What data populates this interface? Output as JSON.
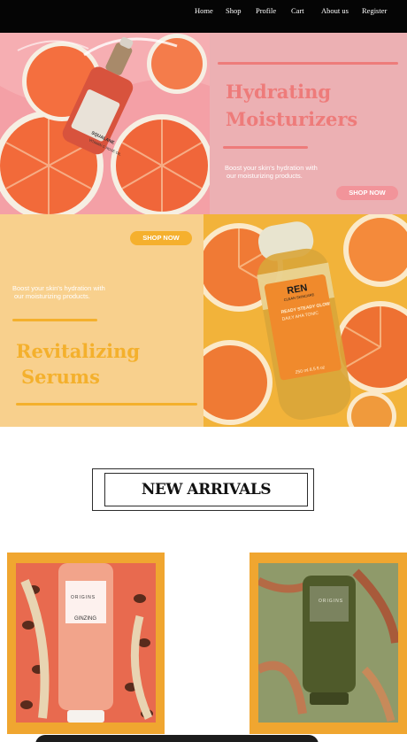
{
  "nav": {
    "items": [
      {
        "id": "home",
        "label": "Home"
      },
      {
        "id": "shop",
        "label": "Shop"
      },
      {
        "id": "profile",
        "label": "Profile"
      },
      {
        "id": "cart",
        "label": "Cart"
      },
      {
        "id": "about",
        "label": "About us"
      },
      {
        "id": "register",
        "label": "Register"
      }
    ]
  },
  "hero_moisturizers": {
    "title_line1": "Hydrating",
    "title_line2": "Moisturizers",
    "text_line1": "Boost your skin's hydration with",
    "text_line2": "our moisturizing products.",
    "cta": "SHOP NOW",
    "bottle_label_line1": "SQUALANE",
    "bottle_label_line2": "VITAMIN C ROSE OIL",
    "colors": {
      "panel": "#ecb0b3",
      "accent": "#ee7b7a",
      "cta_bg": "#f2949a"
    }
  },
  "hero_serums": {
    "title_line1": "Revitalizing",
    "title_line2": "Serums",
    "text_line1": "Boost your skin's hydration with",
    "text_line2": "our moisturizing products.",
    "cta": "SHOP NOW",
    "bottle_brand": "REN",
    "bottle_brand_sub": "CLEAN SKINCARE",
    "bottle_product_line1": "READY STEADY GLOW",
    "bottle_product_line2": "DAILY AHA TONIC",
    "bottle_volume": "250 ml 8.5 fl oz",
    "colors": {
      "panel": "#f8d08d",
      "accent": "#f4b02c",
      "cta_bg": "#f5b02e"
    }
  },
  "new_arrivals": {
    "heading": "NEW ARRIVALS"
  },
  "products": [
    {
      "brand": "ORIGINS",
      "name": "GINZING",
      "tube_color": "#e98a66"
    },
    {
      "brand": "ORIGINS",
      "name": "",
      "tube_color": "#4f5a2a"
    }
  ]
}
